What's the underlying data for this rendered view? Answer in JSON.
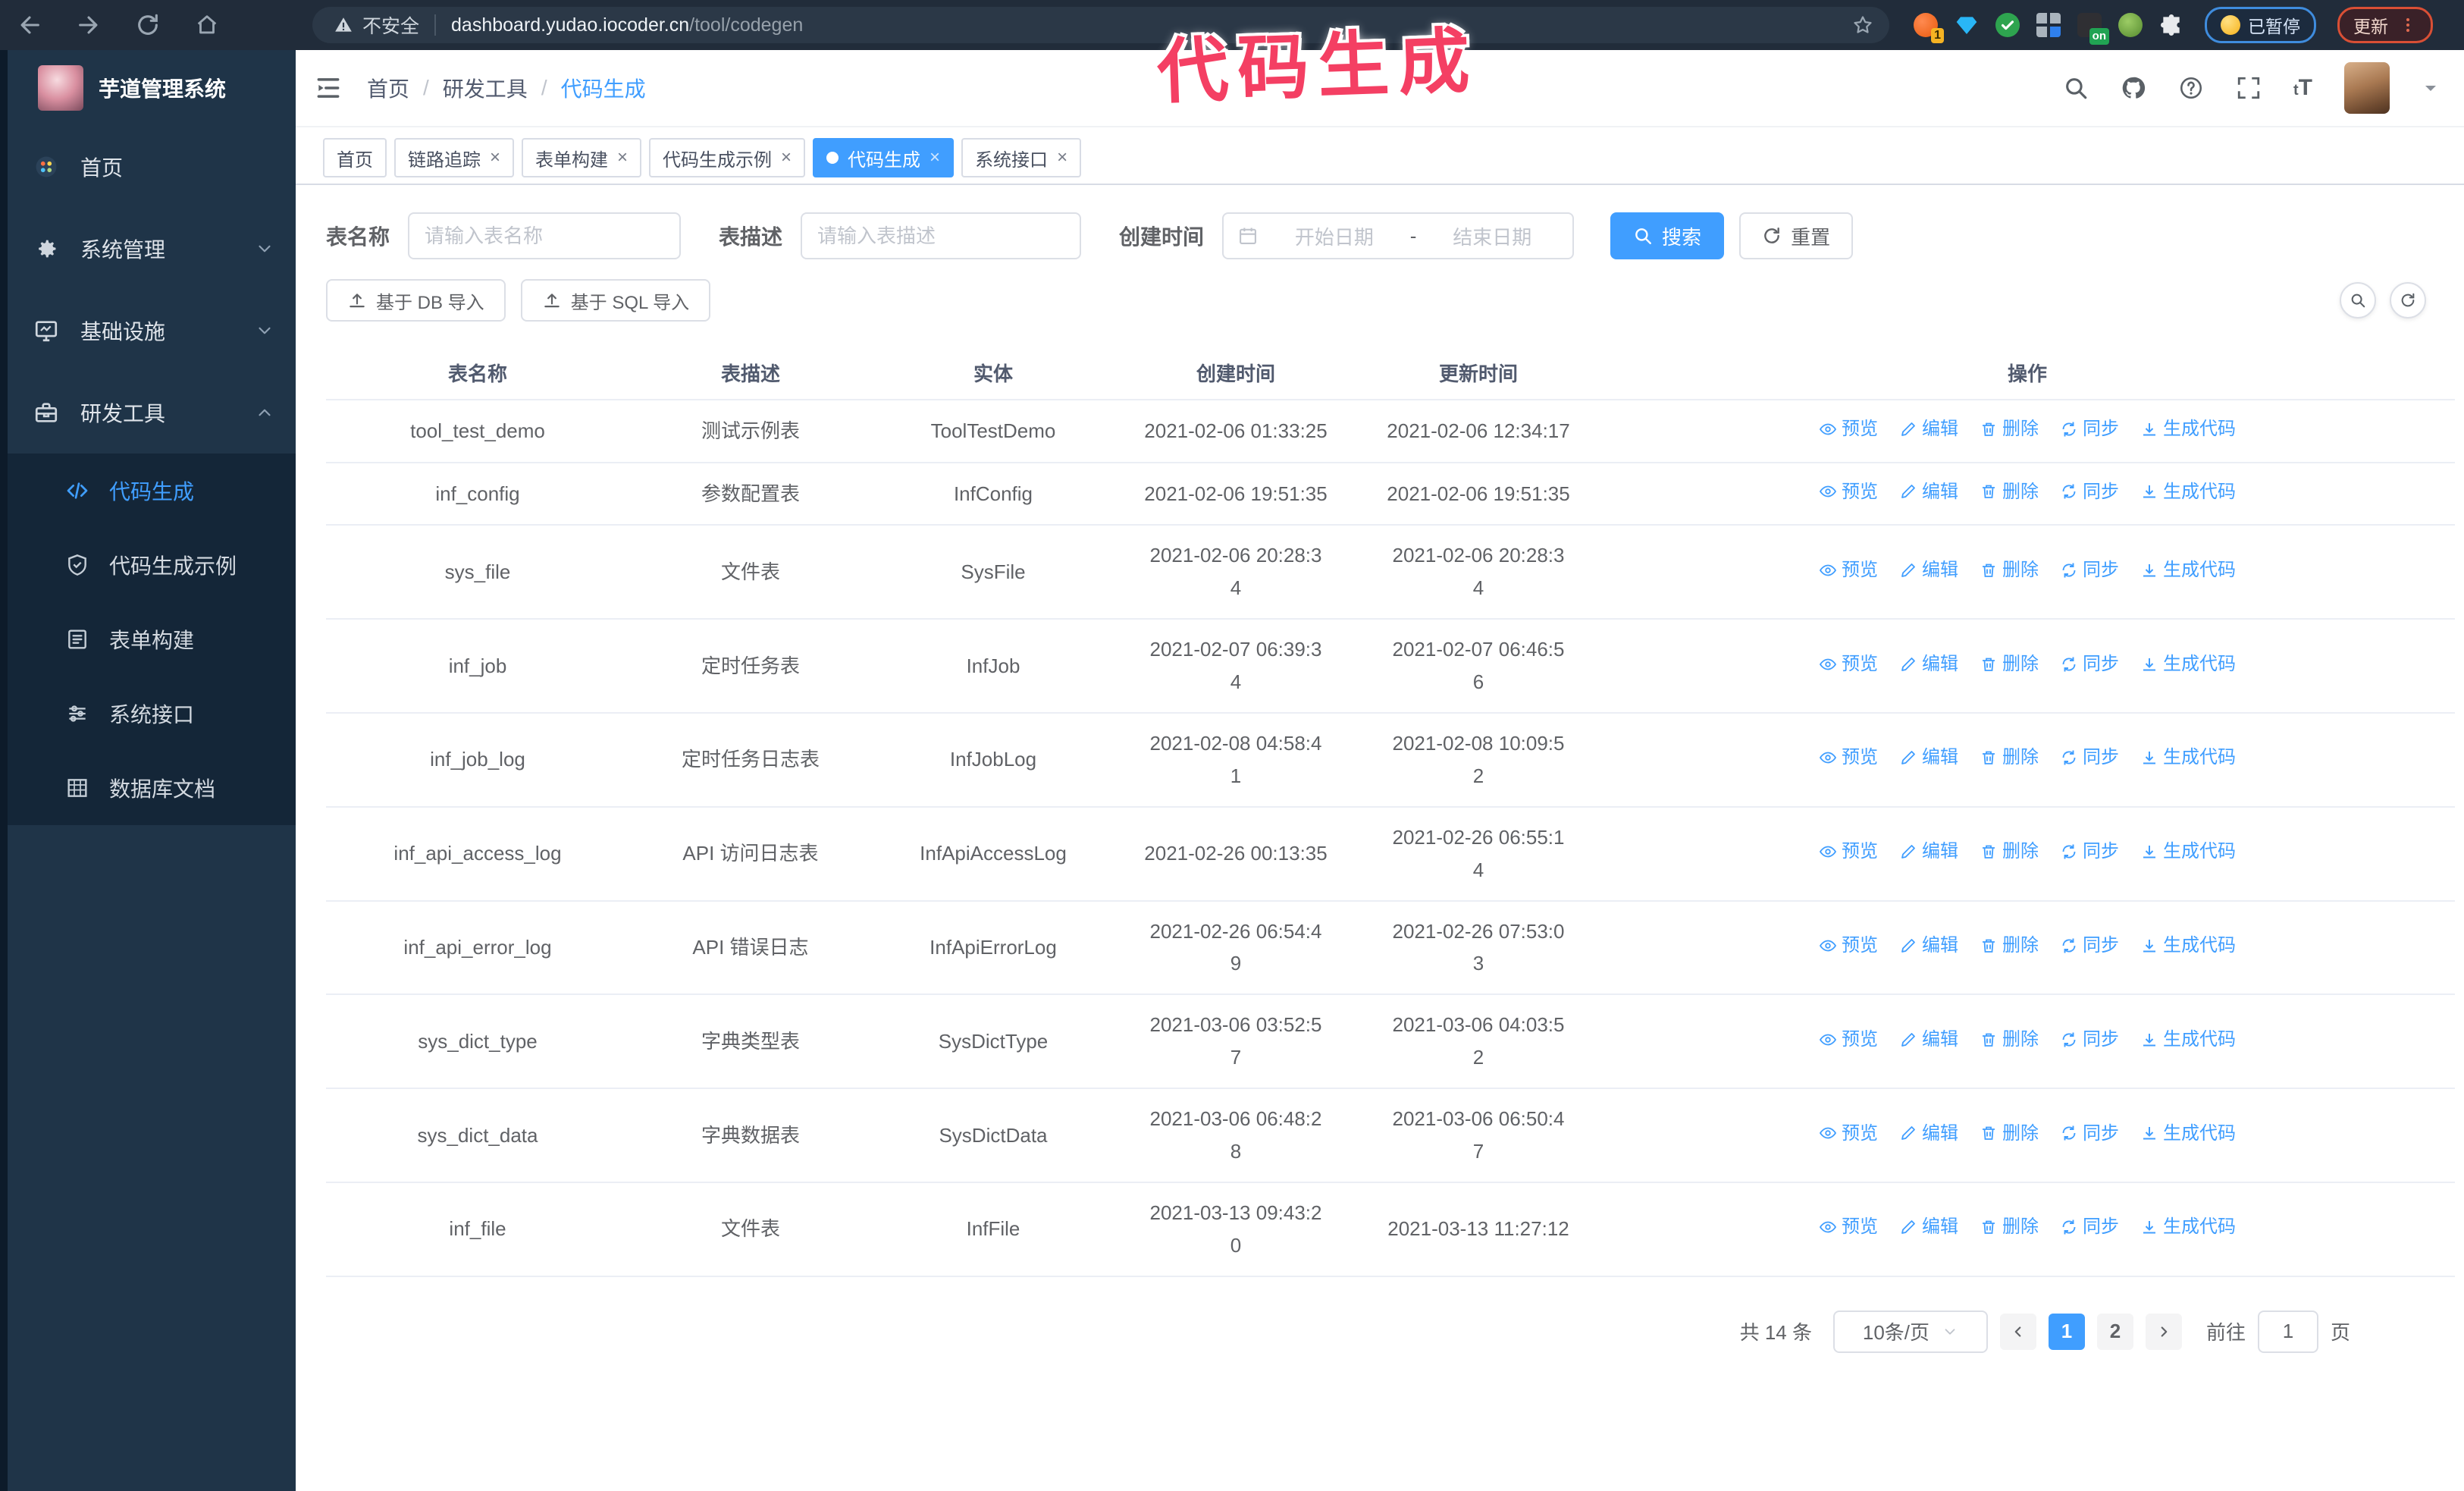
{
  "browser": {
    "security_label": "不安全",
    "url_host": "dashboard.yudao.iocoder.cn",
    "url_path": "/tool/codegen",
    "ext_badge": "1",
    "ext_on": "on",
    "paused_label": "已暂停",
    "update_label": "更新"
  },
  "annotation": {
    "text": "代码生成",
    "color": "#f43f63"
  },
  "sidebar": {
    "title": "芋道管理系统",
    "items": [
      {
        "label": "首页"
      },
      {
        "label": "系统管理"
      },
      {
        "label": "基础设施"
      },
      {
        "label": "研发工具"
      }
    ],
    "subitems": [
      {
        "label": "代码生成",
        "active": true
      },
      {
        "label": "代码生成示例"
      },
      {
        "label": "表单构建"
      },
      {
        "label": "系统接口"
      },
      {
        "label": "数据库文档"
      }
    ]
  },
  "breadcrumb": {
    "items": [
      "首页",
      "研发工具",
      "代码生成"
    ],
    "separator": "/"
  },
  "tabs": [
    {
      "label": "首页",
      "closable": false,
      "active": false
    },
    {
      "label": "链路追踪",
      "closable": true,
      "active": false
    },
    {
      "label": "表单构建",
      "closable": true,
      "active": false
    },
    {
      "label": "代码生成示例",
      "closable": true,
      "active": false
    },
    {
      "label": "代码生成",
      "closable": true,
      "active": true
    },
    {
      "label": "系统接口",
      "closable": true,
      "active": false
    }
  ],
  "search": {
    "name_label": "表名称",
    "name_placeholder": "请输入表名称",
    "desc_label": "表描述",
    "desc_placeholder": "请输入表描述",
    "time_label": "创建时间",
    "start_placeholder": "开始日期",
    "separator": "-",
    "end_placeholder": "结束日期",
    "search_label": "搜索",
    "reset_label": "重置"
  },
  "toolbar": {
    "db_import_label": "基于 DB 导入",
    "sql_import_label": "基于 SQL 导入"
  },
  "table": {
    "columns": [
      "表名称",
      "表描述",
      "实体",
      "创建时间",
      "更新时间",
      "操作"
    ],
    "actions": [
      "预览",
      "编辑",
      "删除",
      "同步",
      "生成代码"
    ],
    "rows": [
      {
        "name": "tool_test_demo",
        "desc": "测试示例表",
        "entity": "ToolTestDemo",
        "created": "2021-02-06 01:33:25",
        "updated": "2021-02-06 12:34:17"
      },
      {
        "name": "inf_config",
        "desc": "参数配置表",
        "entity": "InfConfig",
        "created": "2021-02-06 19:51:35",
        "updated": "2021-02-06 19:51:35"
      },
      {
        "name": "sys_file",
        "desc": "文件表",
        "entity": "SysFile",
        "created": "2021-02-06 20:28:3\n4",
        "updated": "2021-02-06 20:28:3\n4"
      },
      {
        "name": "inf_job",
        "desc": "定时任务表",
        "entity": "InfJob",
        "created": "2021-02-07 06:39:3\n4",
        "updated": "2021-02-07 06:46:5\n6"
      },
      {
        "name": "inf_job_log",
        "desc": "定时任务日志表",
        "entity": "InfJobLog",
        "created": "2021-02-08 04:58:4\n1",
        "updated": "2021-02-08 10:09:5\n2"
      },
      {
        "name": "inf_api_access_log",
        "desc": "API 访问日志表",
        "entity": "InfApiAccessLog",
        "created": "2021-02-26 00:13:35",
        "updated": "2021-02-26 06:55:1\n4"
      },
      {
        "name": "inf_api_error_log",
        "desc": "API 错误日志",
        "entity": "InfApiErrorLog",
        "created": "2021-02-26 06:54:4\n9",
        "updated": "2021-02-26 07:53:0\n3"
      },
      {
        "name": "sys_dict_type",
        "desc": "字典类型表",
        "entity": "SysDictType",
        "created": "2021-03-06 03:52:5\n7",
        "updated": "2021-03-06 04:03:5\n2"
      },
      {
        "name": "sys_dict_data",
        "desc": "字典数据表",
        "entity": "SysDictData",
        "created": "2021-03-06 06:48:2\n8",
        "updated": "2021-03-06 06:50:4\n7"
      },
      {
        "name": "inf_file",
        "desc": "文件表",
        "entity": "InfFile",
        "created": "2021-03-13 09:43:2\n0",
        "updated": "2021-03-13 11:27:12"
      }
    ]
  },
  "pagination": {
    "total": "共 14 条",
    "page_size": "10条/页",
    "pages": [
      "1",
      "2"
    ],
    "goto_label": "前往",
    "goto_value": "1",
    "page_unit": "页"
  },
  "colors": {
    "accent": "#409eff",
    "sidebar_bg": "#1f3448",
    "submenu_bg": "#142638",
    "annotation": "#f43f63"
  }
}
